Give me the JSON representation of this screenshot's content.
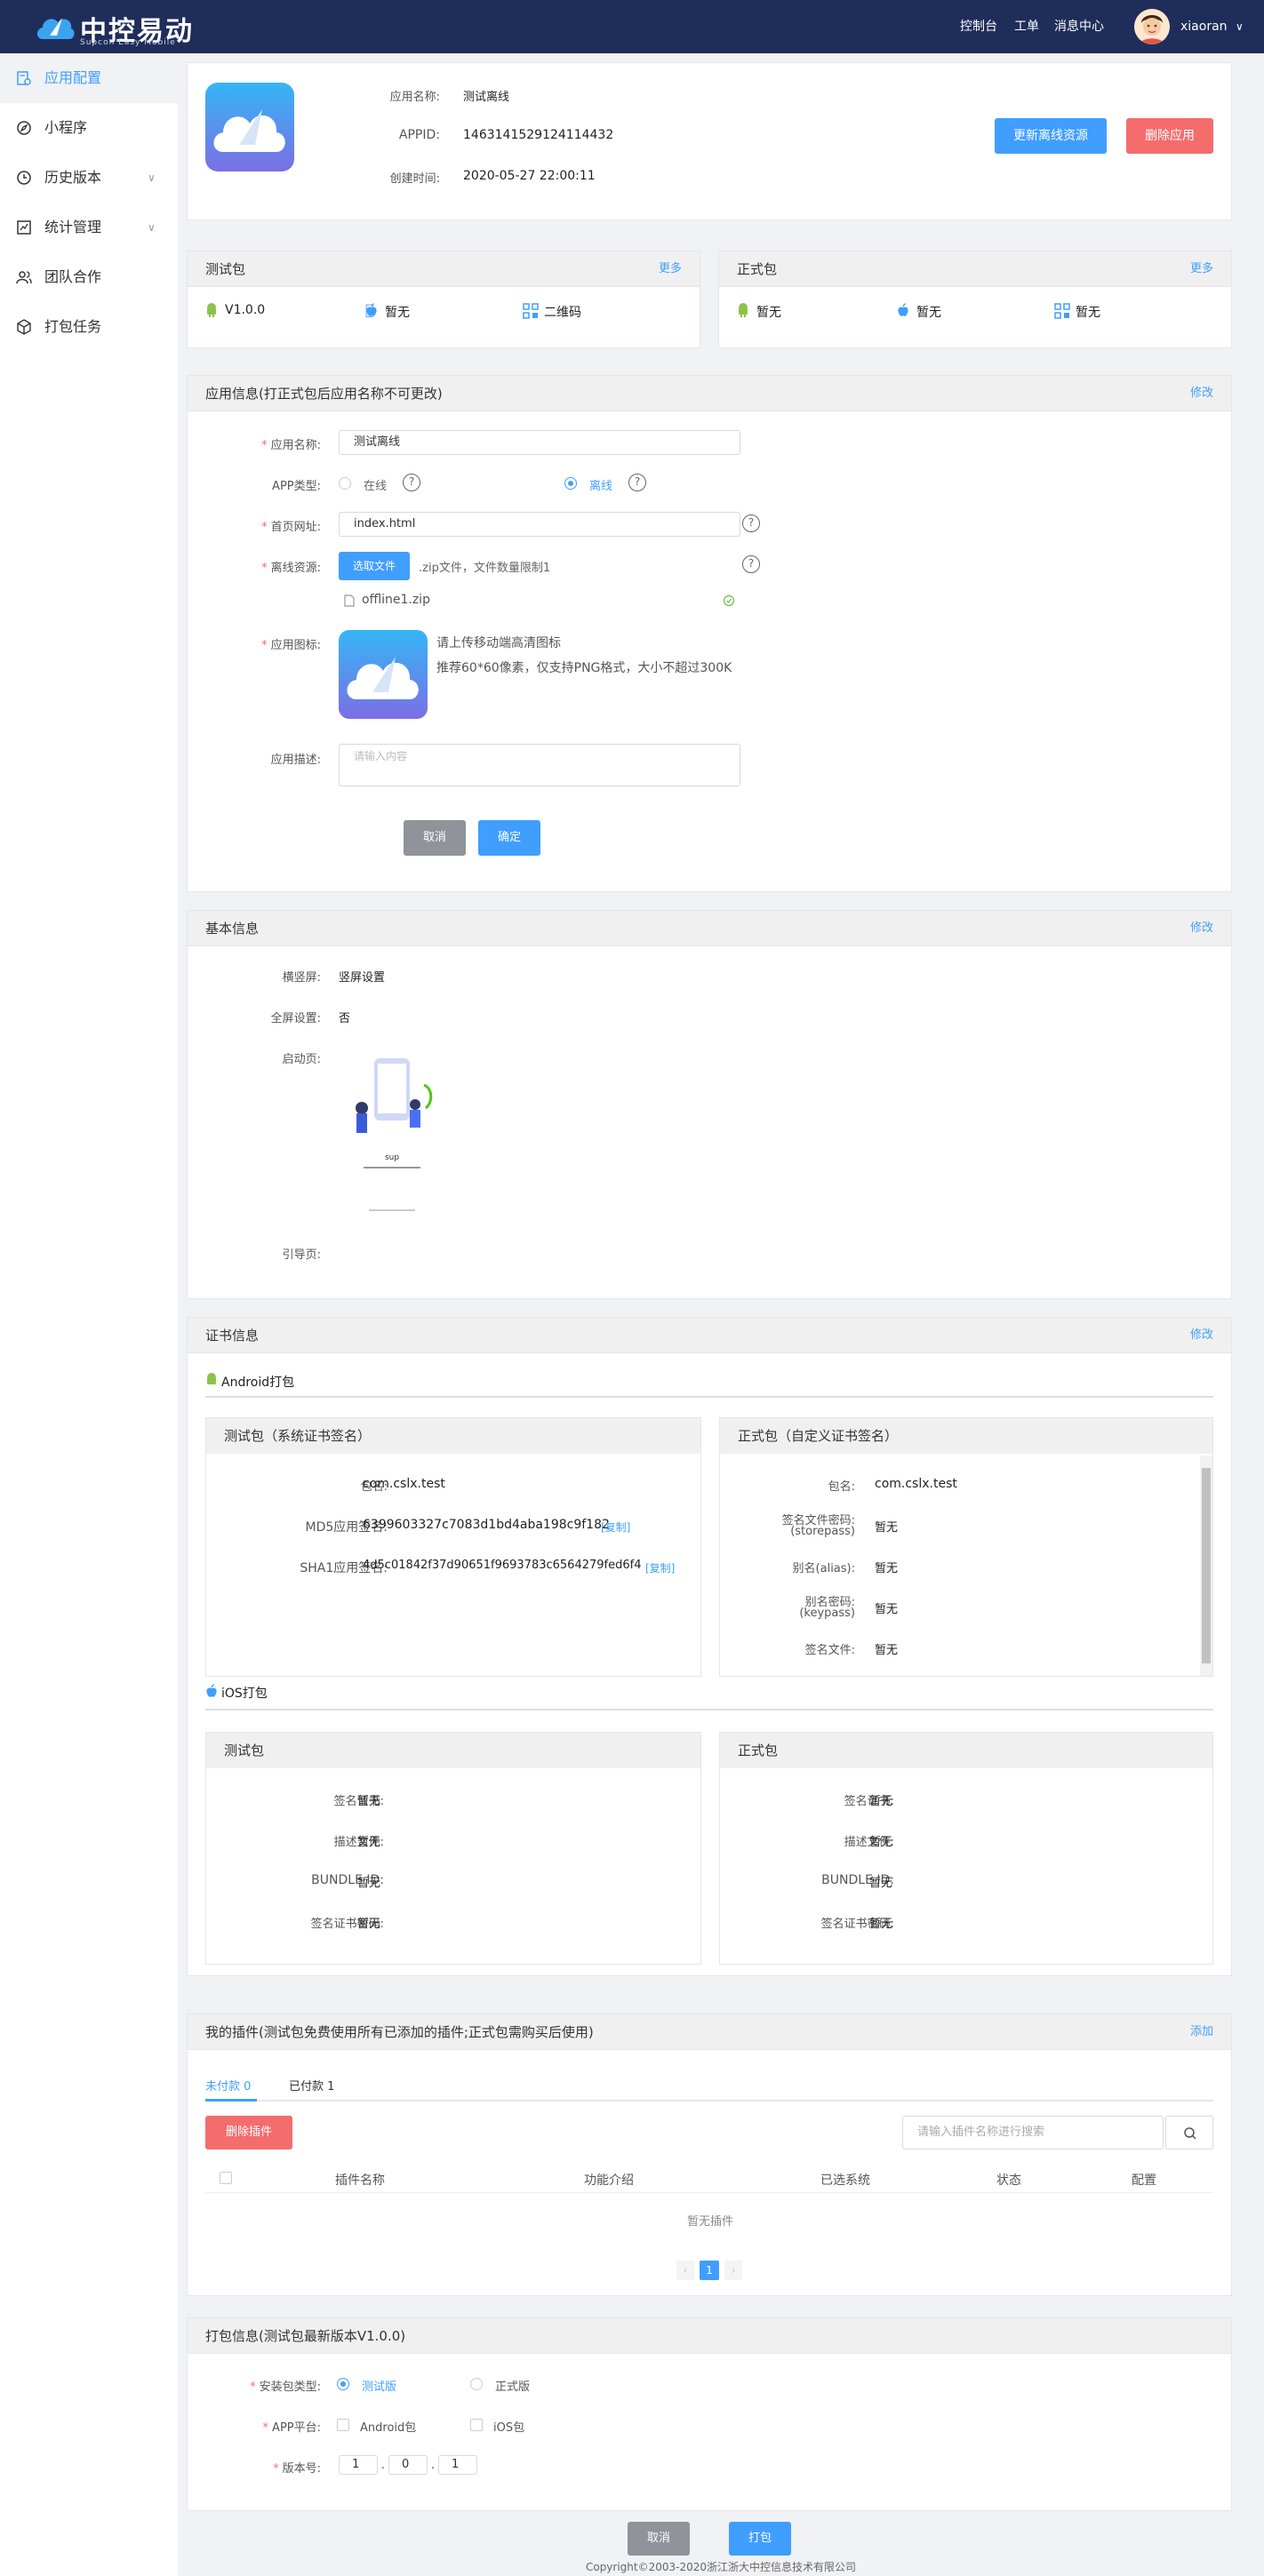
{
  "header": {
    "brand": "中控易动",
    "brand_sub": "Supcon Easy Mobile",
    "nav": [
      "控制台",
      "工单",
      "消息中心"
    ],
    "username": "xiaoran",
    "avatar_icon": "user-avatar"
  },
  "sidebar": {
    "items": [
      {
        "label": "应用配置",
        "icon": "gear-doc-icon",
        "active": true
      },
      {
        "label": "小程序",
        "icon": "compass-icon"
      },
      {
        "label": "历史版本",
        "icon": "history-icon",
        "expandable": true
      },
      {
        "label": "统计管理",
        "icon": "chart-icon",
        "expandable": true
      },
      {
        "label": "团队合作",
        "icon": "team-icon"
      },
      {
        "label": "打包任务",
        "icon": "box-icon"
      }
    ]
  },
  "app_summary": {
    "name_label": "应用名称:",
    "name": "测试离线",
    "appid_label": "APPID:",
    "appid": "1463141529124114432",
    "created_label": "创建时间:",
    "created": "2020-05-27 22:00:11",
    "update_button": "更新离线资源",
    "delete_button": "删除应用"
  },
  "test_package": {
    "title": "测试包",
    "more": "更多",
    "android": "V1.0.0",
    "ios": "暂无",
    "qrcode": "二维码"
  },
  "release_package": {
    "title": "正式包",
    "more": "更多",
    "android": "暂无",
    "ios": "暂无",
    "qrcode": "暂无"
  },
  "app_info": {
    "title": "应用信息(打正式包后应用名称不可更改)",
    "edit": "修改",
    "name_label": "应用名称:",
    "name_value": "测试离线",
    "type_label": "APP类型:",
    "type_online": "在线",
    "type_offline": "离线",
    "homepage_label": "首页网址:",
    "homepage_value": "index.html",
    "resource_label": "离线资源:",
    "choose_file": "选取文件",
    "file_hint": ".zip文件，文件数量限制1",
    "file_name": "offline1.zip",
    "icon_label": "应用图标:",
    "icon_hint1": "请上传移动端高清图标",
    "icon_hint2": "推荐60*60像素，仅支持PNG格式，大小不超过300K",
    "desc_label": "应用描述:",
    "desc_placeholder": "请输入内容",
    "cancel": "取消",
    "confirm": "确定"
  },
  "basic_info": {
    "title": "基本信息",
    "edit": "修改",
    "orientation_label": "横竖屏:",
    "orientation_value": "竖屏设置",
    "fullscreen_label": "全屏设置:",
    "fullscreen_value": "否",
    "splash_label": "启动页:",
    "splash_text": "sup",
    "guide_label": "引导页:"
  },
  "cert_info": {
    "title": "证书信息",
    "edit": "修改",
    "android_title": "Android打包",
    "android_test": {
      "title": "测试包（系统证书签名）",
      "pkg_label": "包名:",
      "pkg": "com.cslx.test",
      "md5_label": "MD5应用签名:",
      "md5": "6399603327c7083d1bd4aba198c9f182",
      "sha1_label": "SHA1应用签名:",
      "sha1": "4d5c01842f37d90651f9693783c6564279fed6f4",
      "copy": "[复制]"
    },
    "android_release": {
      "title": "正式包（自定义证书签名）",
      "pkg_label": "包名:",
      "pkg": "com.cslx.test",
      "storepass_label1": "签名文件密码:",
      "storepass_label2": "(storepass)",
      "storepass": "暂无",
      "alias_label": "别名(alias):",
      "alias": "暂无",
      "keypass_label1": "别名密码:",
      "keypass_label2": "(keypass)",
      "keypass": "暂无",
      "file_label": "签名文件:",
      "file": "暂无"
    },
    "ios_title": "iOS打包",
    "ios_test": {
      "title": "测试包",
      "cert_label": "签名证书:",
      "cert": "暂无",
      "profile_label": "描述文件:",
      "profile": "暂无",
      "bundle_label": "BUNDLE ID:",
      "bundle": "暂无",
      "pwd_label": "签名证书密码:",
      "pwd": "暂无"
    },
    "ios_release": {
      "title": "正式包",
      "cert_label": "签名证书:",
      "cert": "暂无",
      "profile_label": "描述文件:",
      "profile": "暂无",
      "bundle_label": "BUNDLE ID:",
      "bundle": "暂无",
      "pwd_label": "签名证书密码:",
      "pwd": "暂无"
    }
  },
  "plugins": {
    "title": "我的插件(测试包免费使用所有已添加的插件;正式包需购买后使用)",
    "add": "添加",
    "tab_unpaid": "未付款 0",
    "tab_paid": "已付款 1",
    "delete_button": "删除插件",
    "search_placeholder": "请输入插件名称进行搜索",
    "columns": [
      "插件名称",
      "功能介绍",
      "已选系统",
      "状态",
      "配置"
    ],
    "empty": "暂无插件",
    "page": "1"
  },
  "build_info": {
    "title": "打包信息(测试包最新版本V1.0.0)",
    "pkg_type_label": "安装包类型:",
    "pkg_test": "测试版",
    "pkg_release": "正式版",
    "platform_label": "APP平台:",
    "android": "Android包",
    "ios": "iOS包",
    "version_label": "版本号:",
    "version": [
      "1",
      "0",
      "1"
    ],
    "cancel": "取消",
    "build": "打包"
  },
  "footer": {
    "copyright": "Copyright©2003-2020浙江浙大中控信息技术有限公司"
  },
  "colors": {
    "primary": "#409eff",
    "danger": "#f56c6c",
    "header": "#1f2d5a"
  }
}
